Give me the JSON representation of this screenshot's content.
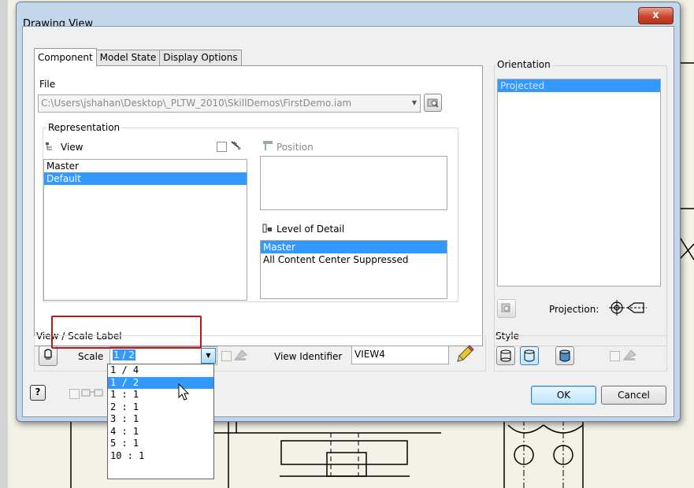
{
  "window": {
    "title": "Drawing View",
    "close_glyph": "x"
  },
  "tabs": [
    "Component",
    "Model State",
    "Display Options"
  ],
  "file": {
    "label": "File",
    "path": "C:\\Users\\jshahan\\Desktop\\_PLTW_2010\\SkillDemos\\FirstDemo.iam"
  },
  "representation": {
    "label": "Representation",
    "view_label": "View",
    "view_items": [
      "Master",
      "Default"
    ],
    "view_selected": "Default",
    "position_label": "Position",
    "lod_label": "Level of Detail",
    "lod_items": [
      "Master",
      "All Content Center Suppressed"
    ],
    "lod_selected": "Master"
  },
  "view_scale": {
    "label": "View / Scale Label",
    "scale_label": "Scale",
    "scale_value": "1 / 2",
    "scale_options": [
      "1 / 4",
      "1 / 2",
      "1 : 1",
      "2 : 1",
      "3 : 1",
      "4 : 1",
      "5 : 1",
      "10 : 1"
    ],
    "scale_selected": "1 / 2",
    "view_identifier_label": "View Identifier",
    "view_identifier_value": "VIEW4"
  },
  "orientation": {
    "label": "Orientation",
    "items": [
      "Projected"
    ],
    "projection_label": "Projection:"
  },
  "style": {
    "label": "Style"
  },
  "buttons": {
    "ok": "OK",
    "cancel": "Cancel",
    "help": "?"
  },
  "colors": {
    "selection": "#3399ff",
    "highlight_box": "#c0141e",
    "dialog_frame": "#c4d6ea"
  }
}
